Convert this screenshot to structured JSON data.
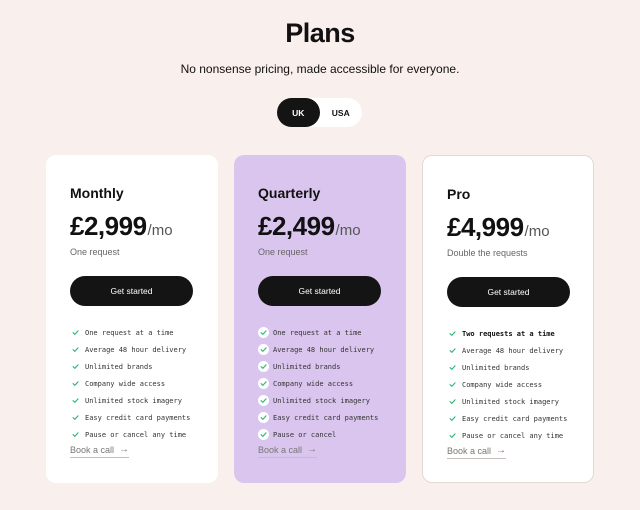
{
  "header": {
    "title": "Plans",
    "subtitle": "No nonsense pricing, made accessible for everyone."
  },
  "region_toggle": {
    "options": [
      "UK",
      "USA"
    ],
    "selected": "UK"
  },
  "plans": [
    {
      "name": "Monthly",
      "price": "£2,999",
      "period": "/mo",
      "requests": "One request",
      "cta": "Get started",
      "features": [
        "One request at a time",
        "Average 48 hour delivery",
        "Unlimited brands",
        "Company wide access",
        "Unlimited stock imagery",
        "Easy credit card payments",
        "Pause or cancel any time"
      ],
      "book_call": "Book a call",
      "book_call_arrow": "→"
    },
    {
      "name": "Quarterly",
      "price": "£2,499",
      "period": "/mo",
      "requests": "One request",
      "cta": "Get started",
      "features": [
        "One request at a time",
        "Average 48 hour delivery",
        "Unlimited brands",
        "Company wide access",
        "Unlimited stock imagery",
        "Easy credit card payments",
        "Pause or cancel"
      ],
      "book_call": "Book a call",
      "book_call_arrow": "→"
    },
    {
      "name": "Pro",
      "price": "£4,999",
      "period": "/mo",
      "requests": "Double the requests",
      "cta": "Get started",
      "features": [
        "Two requests at a time",
        "Average 48 hour delivery",
        "Unlimited brands",
        "Company wide access",
        "Unlimited stock imagery",
        "Easy credit card payments",
        "Pause or cancel any time"
      ],
      "book_call": "Book a call",
      "book_call_arrow": "→"
    }
  ],
  "colors": {
    "background": "#f9efec",
    "card": "#ffffff",
    "featured_card": "#dac5ee",
    "button": "#141414",
    "check": "#2bb673"
  },
  "icons": {
    "check": "check-icon",
    "arrow": "arrow-right-icon"
  }
}
